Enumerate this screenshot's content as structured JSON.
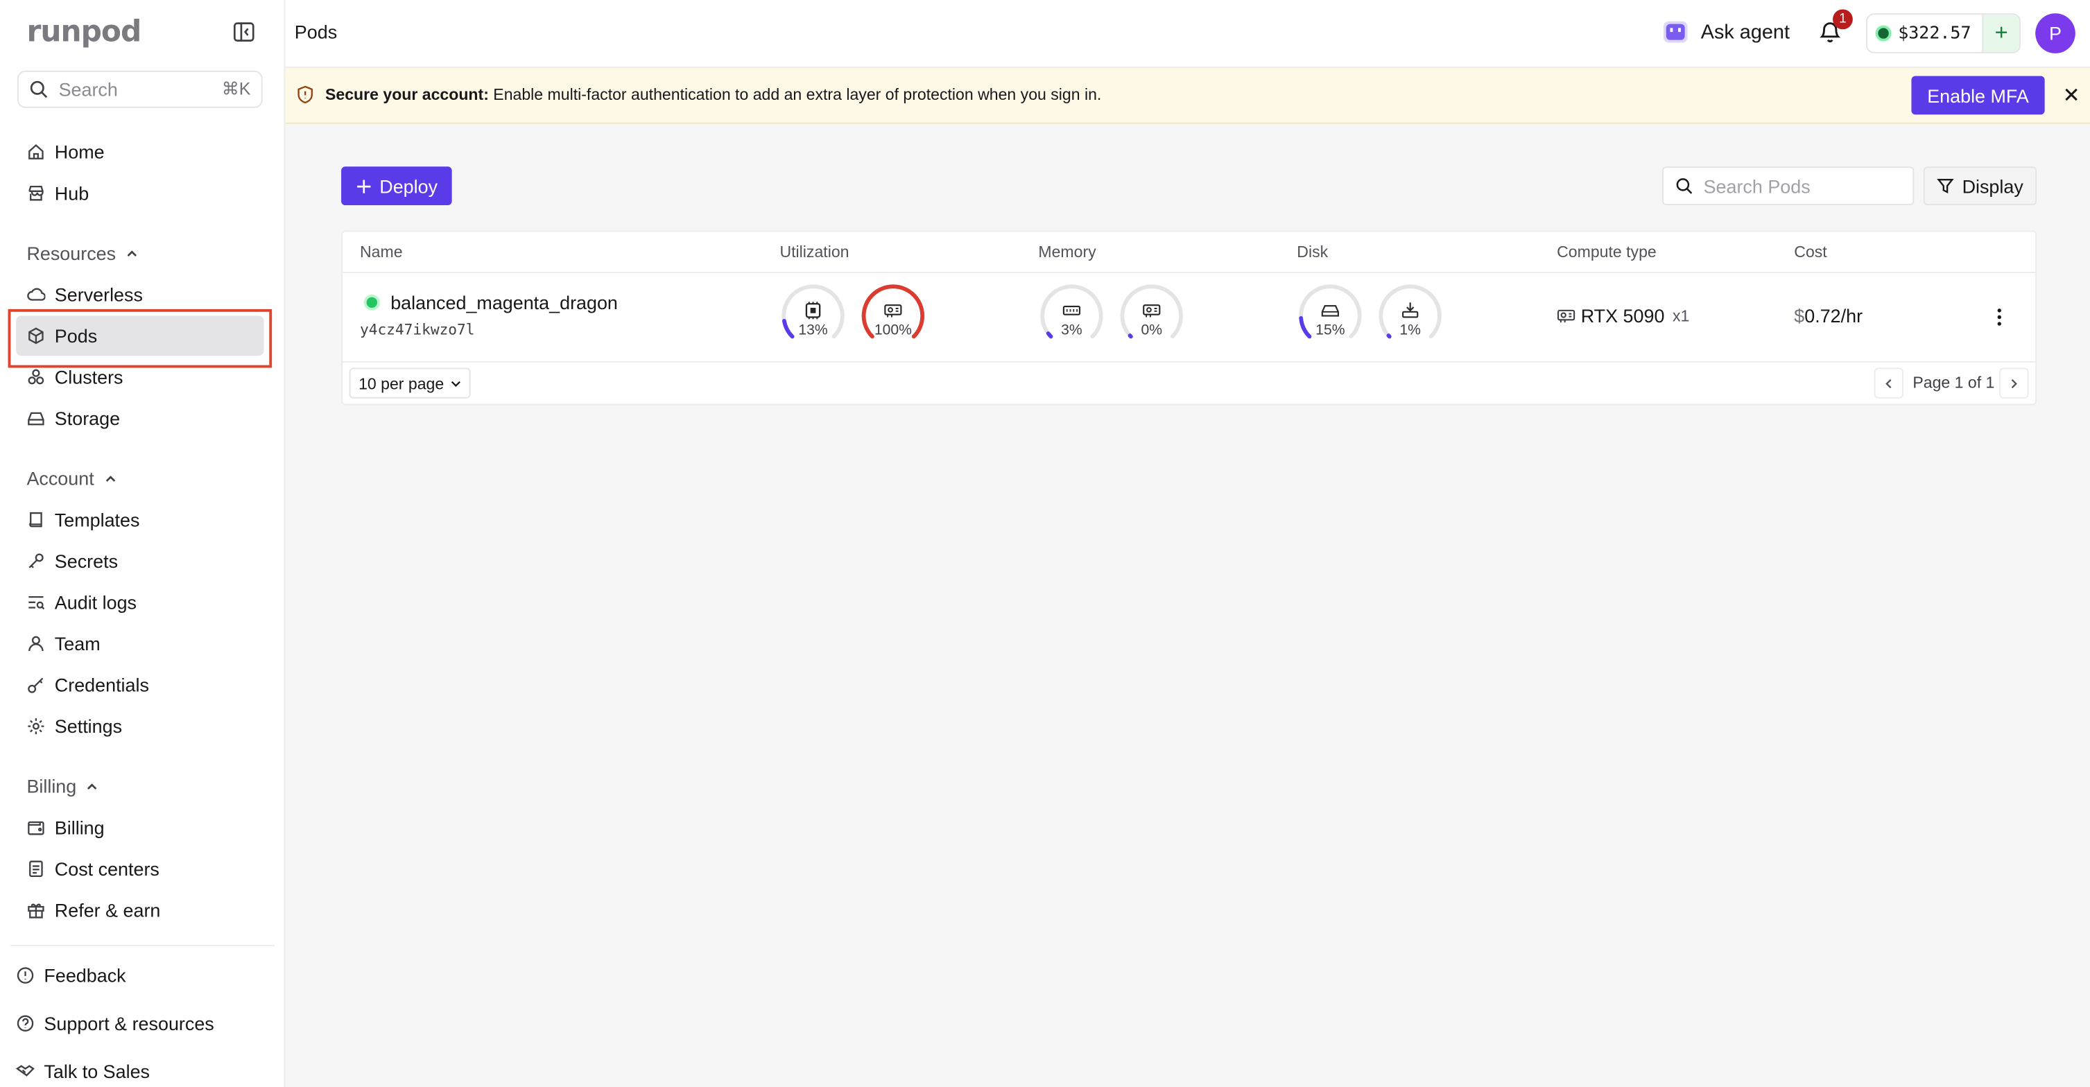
{
  "app": {
    "logo": "runpod"
  },
  "sidebar": {
    "search_placeholder": "Search",
    "search_shortcut": "⌘K",
    "top_items": [
      {
        "label": "Home",
        "icon": "home-icon"
      },
      {
        "label": "Hub",
        "icon": "store-icon"
      }
    ],
    "sections": [
      {
        "title": "Resources",
        "items": [
          {
            "label": "Serverless",
            "icon": "cloud-icon"
          },
          {
            "label": "Pods",
            "icon": "cube-icon",
            "active": true
          },
          {
            "label": "Clusters",
            "icon": "cluster-icon"
          },
          {
            "label": "Storage",
            "icon": "hard-drive-icon"
          }
        ]
      },
      {
        "title": "Account",
        "items": [
          {
            "label": "Templates",
            "icon": "book-icon"
          },
          {
            "label": "Secrets",
            "icon": "key-icon"
          },
          {
            "label": "Audit logs",
            "icon": "logs-icon"
          },
          {
            "label": "Team",
            "icon": "user-icon"
          },
          {
            "label": "Credentials",
            "icon": "credential-key-icon"
          },
          {
            "label": "Settings",
            "icon": "gear-icon"
          }
        ]
      },
      {
        "title": "Billing",
        "items": [
          {
            "label": "Billing",
            "icon": "wallet-icon"
          },
          {
            "label": "Cost centers",
            "icon": "receipt-icon"
          },
          {
            "label": "Refer & earn",
            "icon": "gift-icon"
          }
        ]
      }
    ],
    "footer": [
      {
        "label": "Feedback",
        "icon": "feedback-icon"
      },
      {
        "label": "Support & resources",
        "icon": "help-icon"
      },
      {
        "label": "Talk to Sales",
        "icon": "handshake-icon"
      }
    ]
  },
  "header": {
    "title": "Pods",
    "ask_agent": "Ask agent",
    "notification_count": "1",
    "balance": "$322.57",
    "add_funds": "+",
    "avatar_initial": "P"
  },
  "banner": {
    "bold": "Secure your account:",
    "text": "Enable multi-factor authentication to add an extra layer of protection when you sign in.",
    "button": "Enable MFA"
  },
  "toolbar": {
    "deploy": "Deploy",
    "search_placeholder": "Search Pods",
    "display": "Display"
  },
  "table": {
    "columns": [
      "Name",
      "Utilization",
      "Memory",
      "Disk",
      "Compute type",
      "Cost"
    ],
    "rows": [
      {
        "status": "running",
        "name": "balanced_magenta_dragon",
        "id": "y4cz47ikwzo7l",
        "utilization": [
          {
            "label": "13%",
            "value": 13,
            "icon": "cpu-icon"
          },
          {
            "label": "100%",
            "value": 100,
            "icon": "gpu-icon"
          }
        ],
        "memory": [
          {
            "label": "3%",
            "value": 3,
            "icon": "ram-icon"
          },
          {
            "label": "0%",
            "value": 0,
            "icon": "gpu-memory-icon"
          }
        ],
        "disk": [
          {
            "label": "15%",
            "value": 15,
            "icon": "disk-icon"
          },
          {
            "label": "1%",
            "value": 1,
            "icon": "volume-icon"
          }
        ],
        "compute": "RTX 5090",
        "compute_count": "x1",
        "cost_currency": "$",
        "cost": "0.72/hr"
      }
    ],
    "per_page": "10 per page",
    "page_info": "Page 1 of 1"
  },
  "colors": {
    "accent": "#5b3be8",
    "gauge_normal": "#5b3be8",
    "gauge_high": "#dc3b2f",
    "gauge_track": "#e4e4e7",
    "highlight": "#e0442d"
  }
}
